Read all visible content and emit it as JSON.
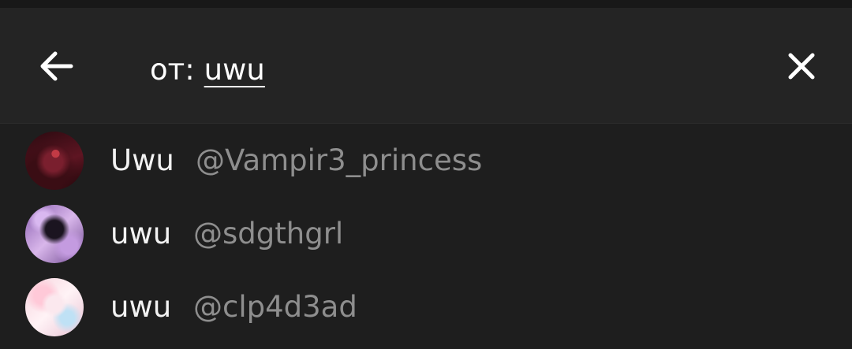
{
  "search": {
    "prefix": "от:",
    "term": "uwu"
  },
  "icons": {
    "back": "arrow-left-icon",
    "clear": "close-icon"
  },
  "colors": {
    "background": "#1e1e1e",
    "header": "#242424",
    "primary_text": "#ffffff",
    "secondary_text": "#8e8e8e"
  },
  "results": [
    {
      "display_name": "Uwu",
      "handle": "@Vampir3_princess"
    },
    {
      "display_name": "uwu",
      "handle": "@sdgthgrl"
    },
    {
      "display_name": "uwu",
      "handle": "@clp4d3ad"
    }
  ]
}
